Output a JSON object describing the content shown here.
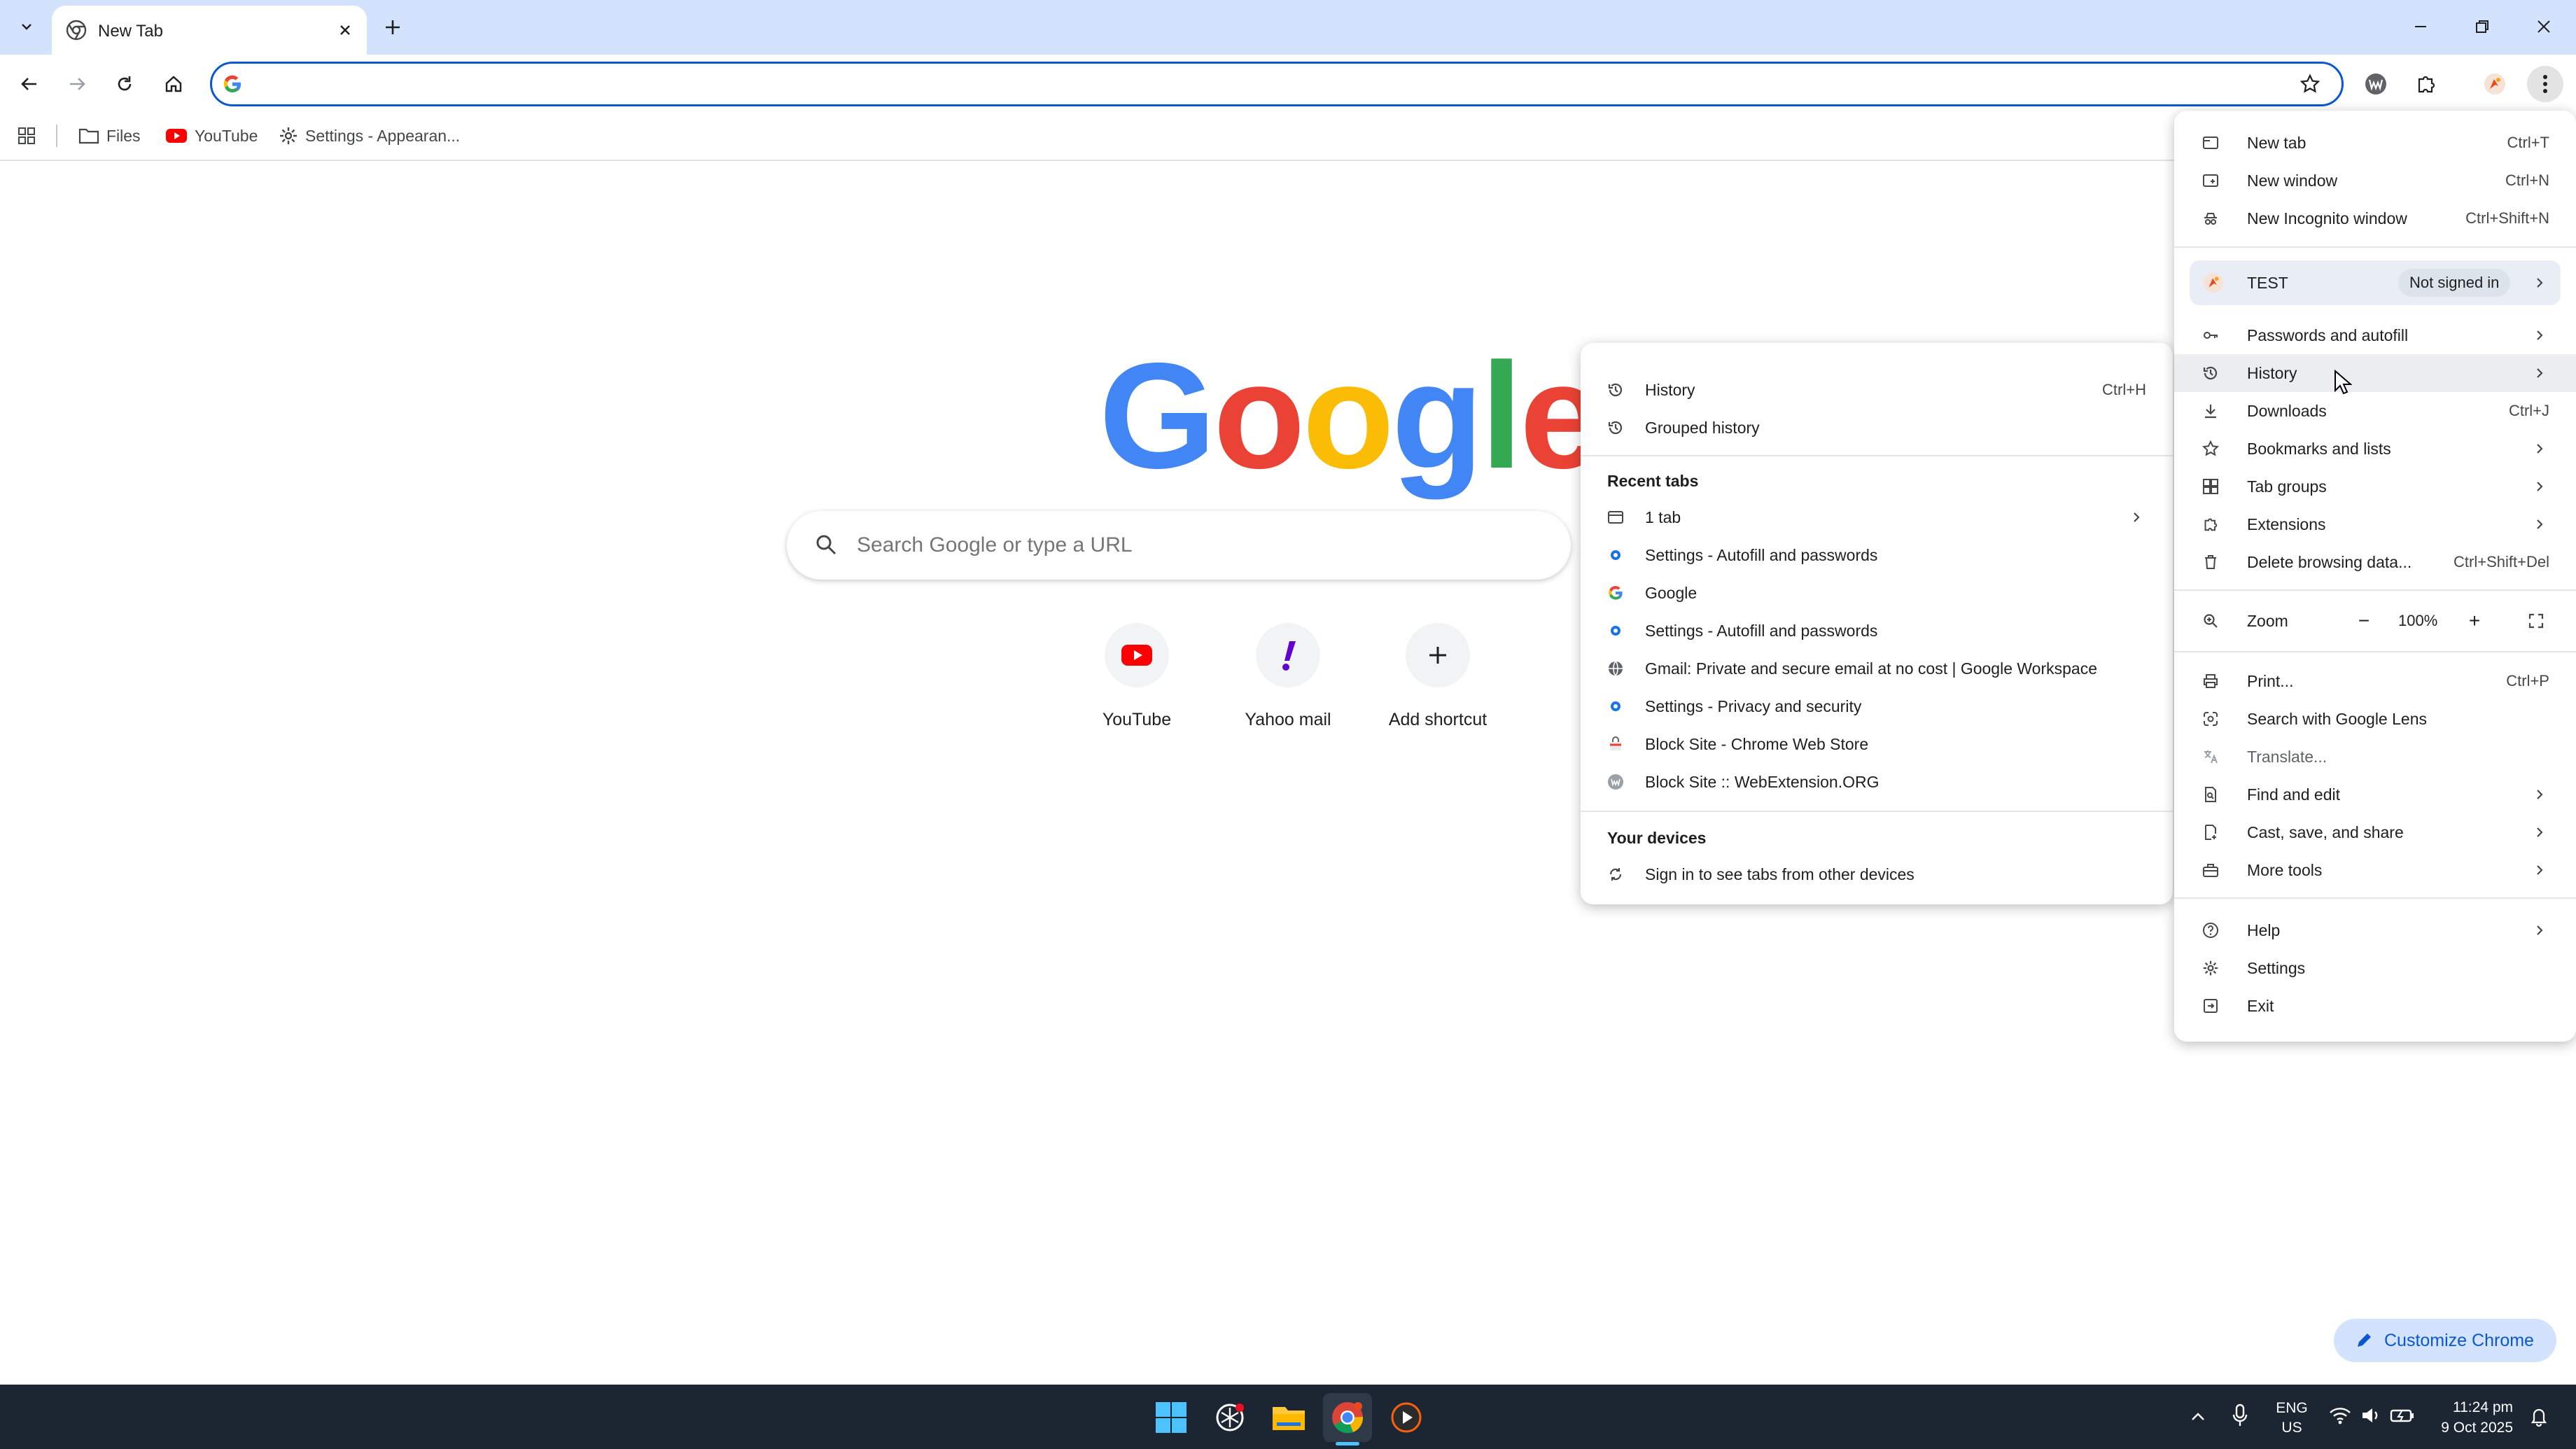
{
  "tab": {
    "title": "New Tab"
  },
  "omnibox": {
    "value": ""
  },
  "bookmarks": [
    {
      "label": "Files",
      "icon": "folder-icon"
    },
    {
      "label": "YouTube",
      "icon": "youtube-icon"
    },
    {
      "label": "Settings - Appearan...",
      "icon": "gear-icon"
    }
  ],
  "ntp": {
    "logo": [
      "G",
      "o",
      "o",
      "g",
      "l",
      "e"
    ],
    "search_placeholder": "Search Google or type a URL",
    "shortcuts": [
      {
        "label": "YouTube"
      },
      {
        "label": "Yahoo mail"
      },
      {
        "label": "Add shortcut"
      }
    ],
    "customize_label": "Customize Chrome"
  },
  "main_menu": {
    "new_tab": {
      "label": "New tab",
      "shortcut": "Ctrl+T"
    },
    "new_window": {
      "label": "New window",
      "shortcut": "Ctrl+N"
    },
    "incognito": {
      "label": "New Incognito window",
      "shortcut": "Ctrl+Shift+N"
    },
    "profile": {
      "name": "TEST",
      "status": "Not signed in"
    },
    "passwords": {
      "label": "Passwords and autofill"
    },
    "history": {
      "label": "History"
    },
    "downloads": {
      "label": "Downloads",
      "shortcut": "Ctrl+J"
    },
    "bookmarks": {
      "label": "Bookmarks and lists"
    },
    "tab_groups": {
      "label": "Tab groups"
    },
    "extensions": {
      "label": "Extensions"
    },
    "delete_data": {
      "label": "Delete browsing data...",
      "shortcut": "Ctrl+Shift+Del"
    },
    "zoom": {
      "label": "Zoom",
      "value": "100%",
      "minus": "−",
      "plus": "+"
    },
    "print": {
      "label": "Print...",
      "shortcut": "Ctrl+P"
    },
    "lens": {
      "label": "Search with Google Lens"
    },
    "translate": {
      "label": "Translate..."
    },
    "find_edit": {
      "label": "Find and edit"
    },
    "cast": {
      "label": "Cast, save, and share"
    },
    "more_tools": {
      "label": "More tools"
    },
    "help": {
      "label": "Help"
    },
    "settings": {
      "label": "Settings"
    },
    "exit": {
      "label": "Exit"
    }
  },
  "history_menu": {
    "history": {
      "label": "History",
      "shortcut": "Ctrl+H"
    },
    "grouped": {
      "label": "Grouped history"
    },
    "recent_header": "Recent tabs",
    "recent": [
      {
        "label": "1 tab",
        "icon": "window-icon"
      },
      {
        "label": "Settings - Autofill and passwords",
        "icon": "gear-icon"
      },
      {
        "label": "Google",
        "icon": "google-icon"
      },
      {
        "label": "Settings - Autofill and passwords",
        "icon": "gear-icon"
      },
      {
        "label": "Gmail: Private and secure email at no cost | Google Workspace",
        "icon": "globe-icon"
      },
      {
        "label": "Settings - Privacy and security",
        "icon": "gear-icon"
      },
      {
        "label": "Block Site - Chrome Web Store",
        "icon": "webstore-icon"
      },
      {
        "label": "Block Site :: WebExtension.ORG",
        "icon": "w-badge-icon"
      }
    ],
    "devices_header": "Your devices",
    "devices_signin": "Sign in to see tabs from other devices"
  },
  "taskbar": {
    "lang": "ENG",
    "region": "US",
    "time": "11:24 pm",
    "date": "9 Oct 2025"
  },
  "colors": {
    "tabstrip": "#d3e3fd",
    "accent": "#0b57d0",
    "taskbar": "#1c2633"
  }
}
